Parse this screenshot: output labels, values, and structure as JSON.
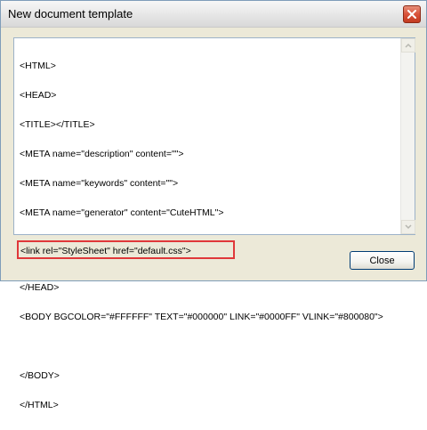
{
  "window": {
    "title": "New document template"
  },
  "editor": {
    "lines_before": [
      "<HTML>",
      "<HEAD>",
      "<TITLE></TITLE>",
      "<META name=\"description\" content=\"\">",
      "<META name=\"keywords\" content=\"\">",
      "<META name=\"generator\" content=\"CuteHTML\">"
    ],
    "highlighted_line": "<link rel=\"StyleSheet\" href=\"default.css\">",
    "lines_after": [
      "</HEAD>",
      "<BODY BGCOLOR=\"#FFFFFF\" TEXT=\"#000000\" LINK=\"#0000FF\" VLINK=\"#800080\">",
      "",
      "</BODY>",
      "</HTML>"
    ],
    "highlight_color": "#e0383a"
  },
  "buttons": {
    "close_label": "Close"
  },
  "icons": {
    "titlebar_close": "close-icon",
    "scroll_up": "scroll-up-arrow-icon",
    "scroll_down": "scroll-down-arrow-icon"
  }
}
